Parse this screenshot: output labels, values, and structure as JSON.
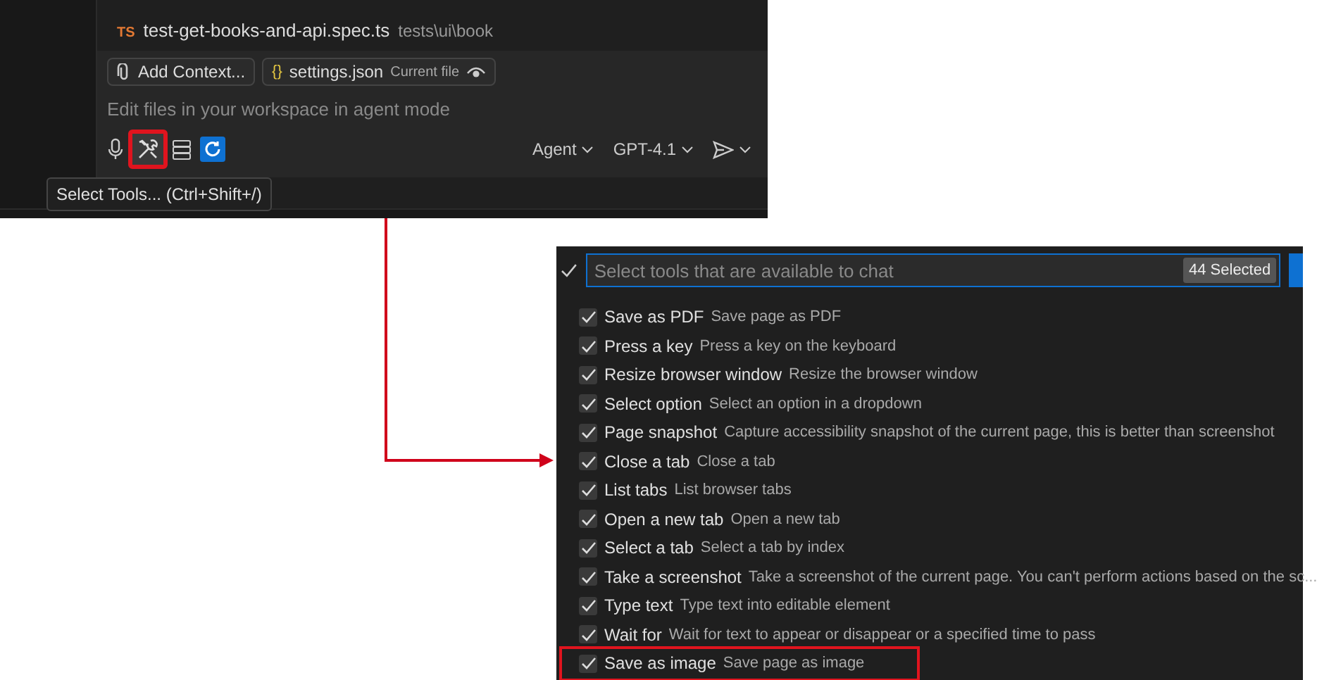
{
  "chat_panel": {
    "context_files": [
      {
        "badge": "TS",
        "name": "test-get-books-and-api.spec.ts",
        "path": "tests\\ui\\book"
      }
    ],
    "add_context": "Add Context...",
    "attachment": {
      "icon": "{}",
      "name": "settings.json",
      "note": "Current file"
    },
    "placeholder": "Edit files in your workspace in agent mode",
    "tools_highlighted": true,
    "mode": "Agent",
    "model": "GPT-4.1",
    "tooltip": "Select Tools... (Ctrl+Shift+/)"
  },
  "tool_picker": {
    "placeholder": "Select tools that are available to chat",
    "badge": "44 Selected",
    "items": [
      {
        "name": "Save as PDF",
        "description": "Save page as PDF",
        "checked": true,
        "highlighted": false
      },
      {
        "name": "Press a key",
        "description": "Press a key on the keyboard",
        "checked": true,
        "highlighted": false
      },
      {
        "name": "Resize browser window",
        "description": "Resize the browser window",
        "checked": true,
        "highlighted": false
      },
      {
        "name": "Select option",
        "description": "Select an option in a dropdown",
        "checked": true,
        "highlighted": false
      },
      {
        "name": "Page snapshot",
        "description": "Capture accessibility snapshot of the current page, this is better than screenshot",
        "checked": true,
        "highlighted": false
      },
      {
        "name": "Close a tab",
        "description": "Close a tab",
        "checked": true,
        "highlighted": false
      },
      {
        "name": "List tabs",
        "description": "List browser tabs",
        "checked": true,
        "highlighted": false
      },
      {
        "name": "Open a new tab",
        "description": "Open a new tab",
        "checked": true,
        "highlighted": false
      },
      {
        "name": "Select a tab",
        "description": "Select a tab by index",
        "checked": true,
        "highlighted": false
      },
      {
        "name": "Take a screenshot",
        "description": "Take a screenshot of the current page. You can't perform actions based on the sc...",
        "checked": true,
        "highlighted": false
      },
      {
        "name": "Type text",
        "description": "Type text into editable element",
        "checked": true,
        "highlighted": false
      },
      {
        "name": "Wait for",
        "description": "Wait for text to appear or disappear or a specified time to pass",
        "checked": true,
        "highlighted": false
      },
      {
        "name": "Save as image",
        "description": "Save page as image",
        "checked": true,
        "highlighted": true
      }
    ]
  }
}
